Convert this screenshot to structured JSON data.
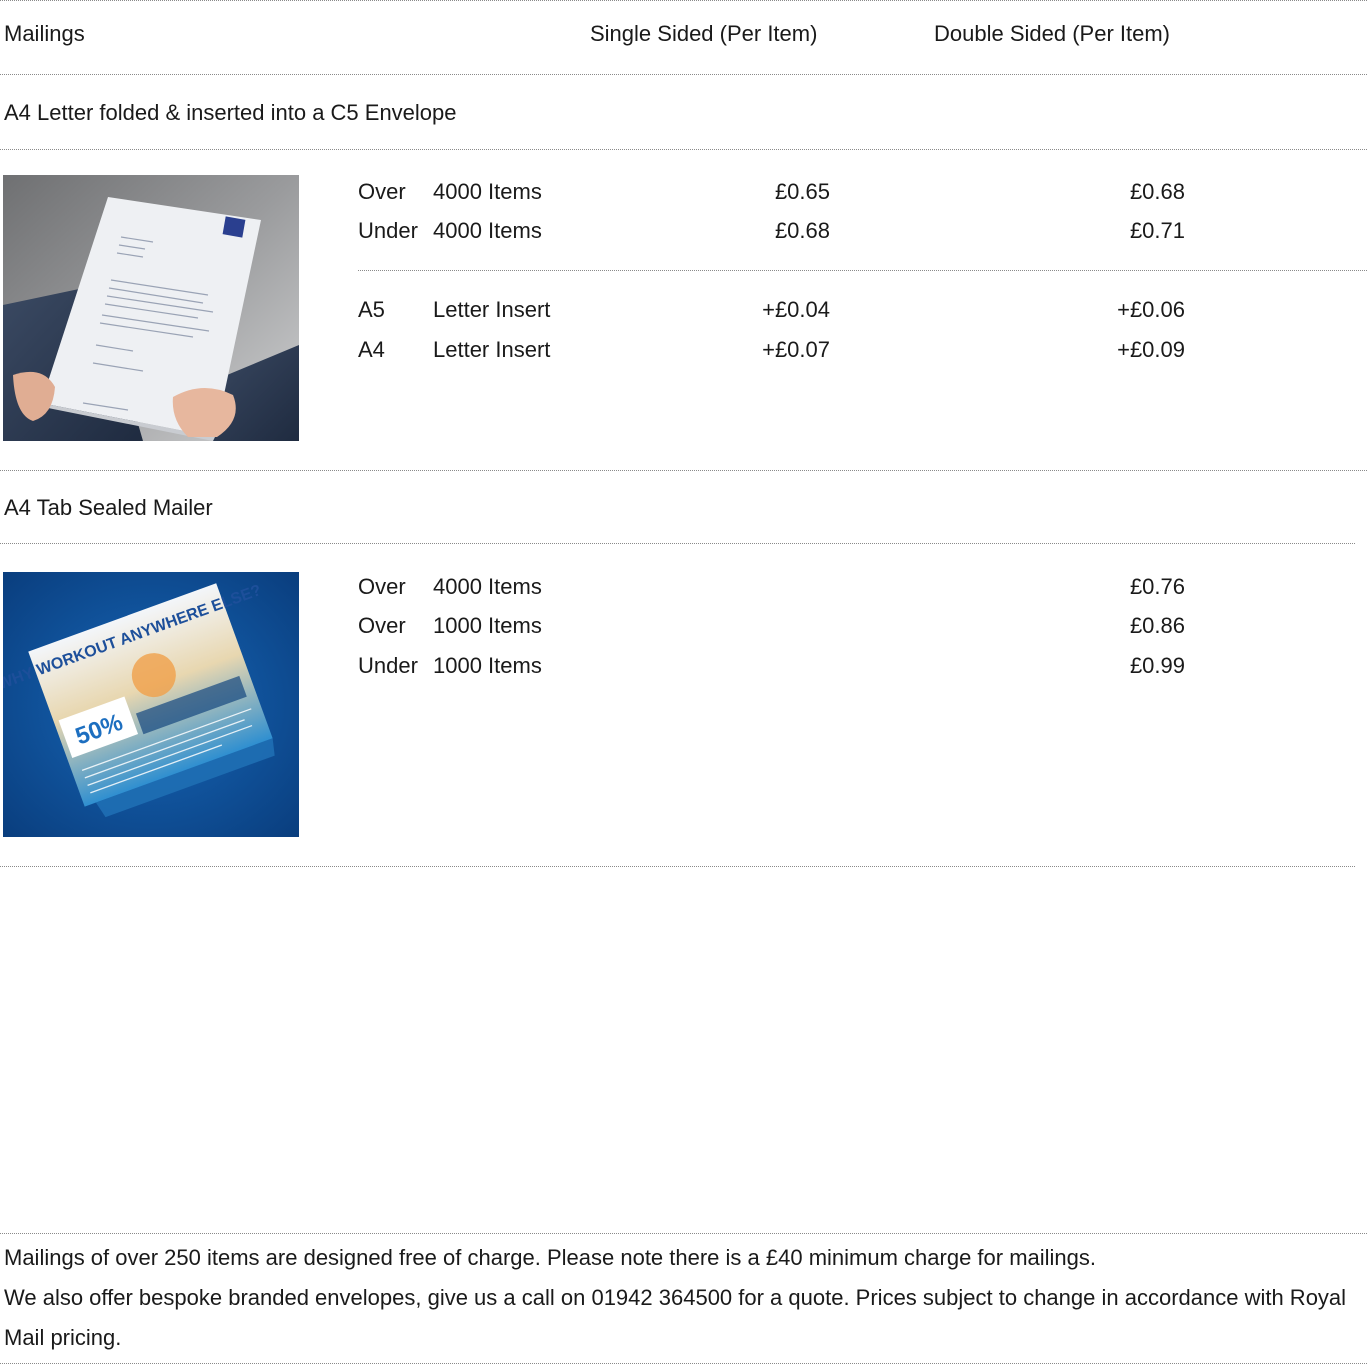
{
  "header": {
    "col_mailings": "Mailings",
    "col_single": "Single Sided (Per Item)",
    "col_double": "Double Sided (Per Item)"
  },
  "sections": [
    {
      "title": "A4 Letter folded & inserted into a C5 Envelope",
      "image_alt": "hands holding a printed A4 letter",
      "rows": [
        {
          "a": "Over",
          "b": "4000 Items",
          "single": "£0.65",
          "double": "£0.68"
        },
        {
          "a": "Under",
          "b": "4000 Items",
          "single": "£0.68",
          "double": "£0.71"
        }
      ],
      "inserts": [
        {
          "a": "A5",
          "b": "Letter Insert",
          "single": "+£0.04",
          "double": "+£0.06"
        },
        {
          "a": "A4",
          "b": "Letter Insert",
          "single": "+£0.07",
          "double": "+£0.09"
        }
      ]
    },
    {
      "title": "A4 Tab Sealed Mailer",
      "image_alt": "folded tab sealed mailer on blue background",
      "mailer_image_text": {
        "headline": "WHY WORKOUT ANYWHERE ELSE?",
        "badge": "50%"
      },
      "rows": [
        {
          "a": "Over",
          "b": "4000 Items",
          "double": "£0.76"
        },
        {
          "a": "Over",
          "b": "1000 Items",
          "double": "£0.86"
        },
        {
          "a": "Under",
          "b": "1000 Items",
          "double": "£0.99"
        }
      ]
    }
  ],
  "footer": {
    "line1": "Mailings of over 250 items are designed free of charge. Please note there is a £40 minimum charge for mailings.",
    "line2": "We also offer bespoke branded envelopes, give us a call on 01942 364500 for a quote. Prices subject to change in accordance with Royal Mail pricing."
  },
  "colors": {
    "text": "#1a1a1a",
    "rule": "#8a8a8a",
    "mailer_background": "#0b4a8e"
  }
}
